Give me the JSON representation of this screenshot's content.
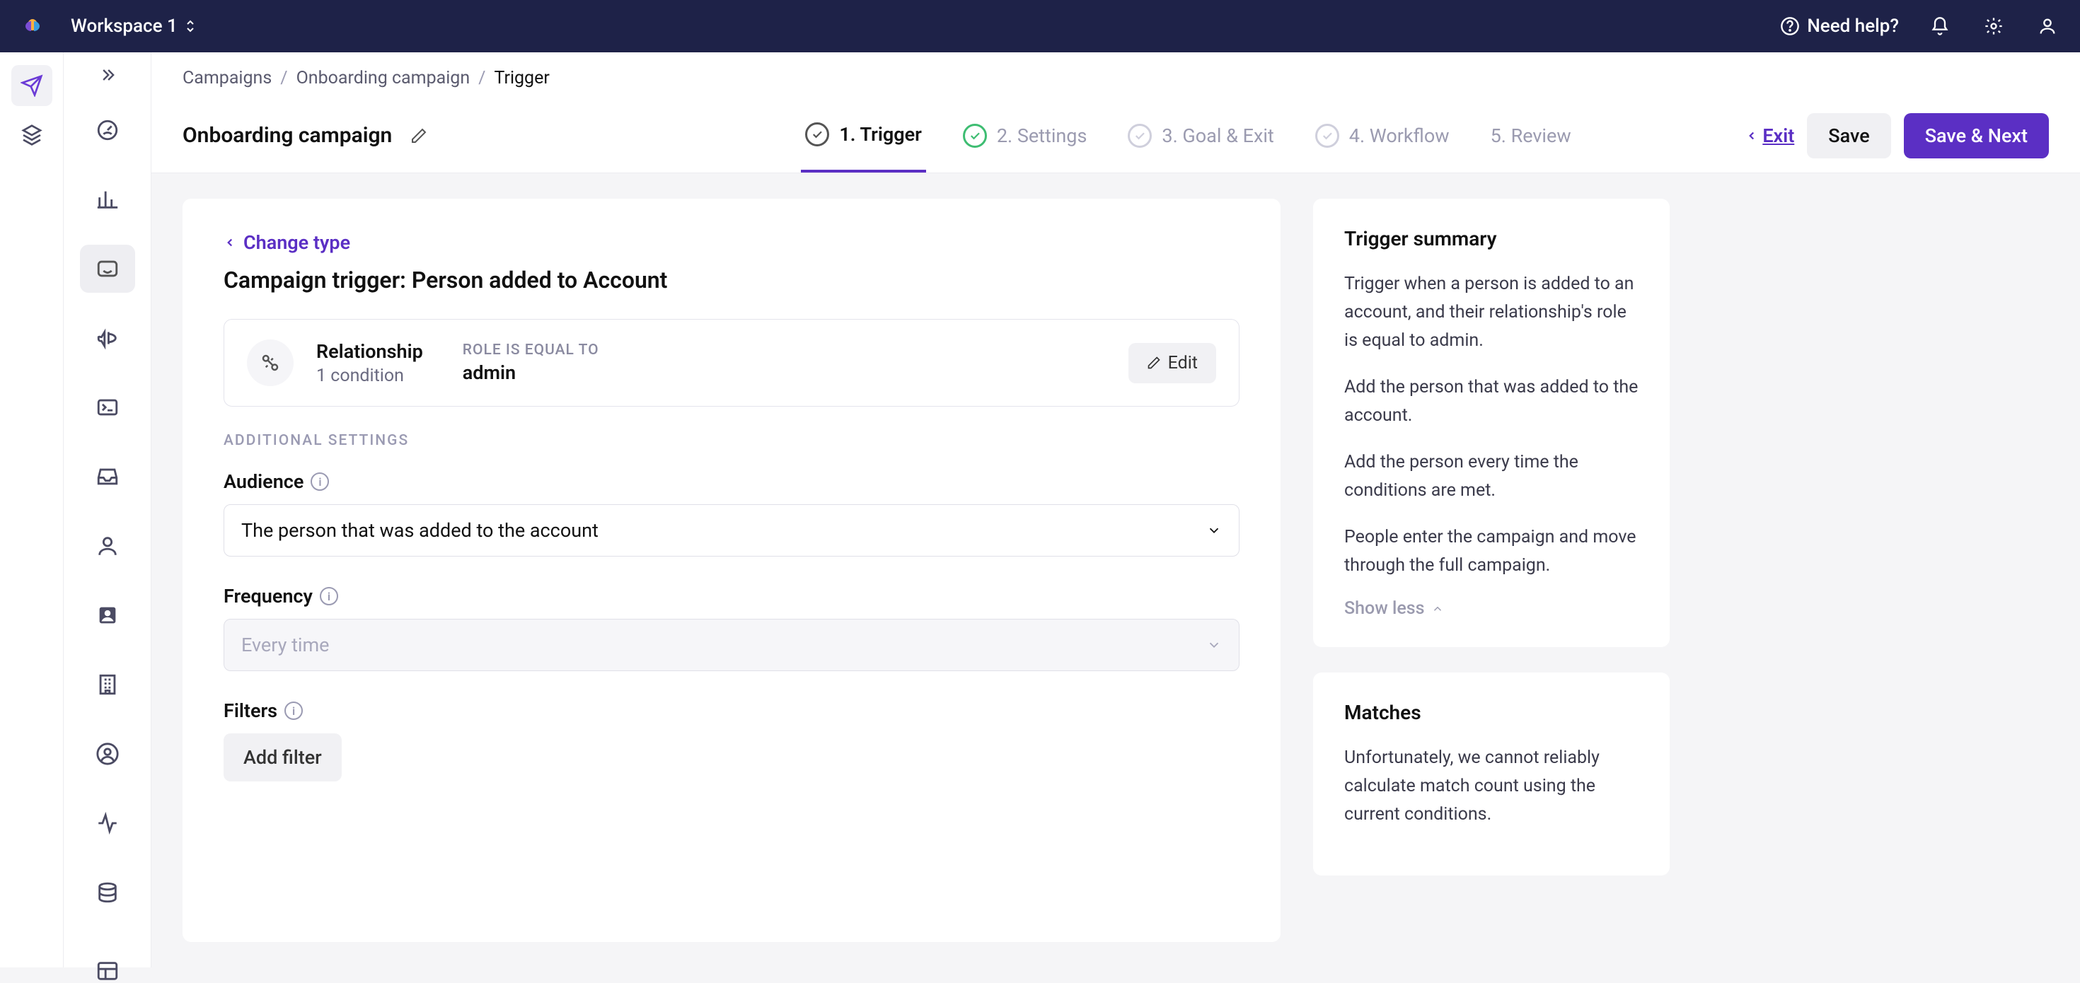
{
  "header": {
    "workspace_label": "Workspace 1",
    "need_help": "Need help?"
  },
  "breadcrumbs": {
    "items": [
      "Campaigns",
      "Onboarding campaign",
      "Trigger"
    ]
  },
  "page": {
    "title": "Onboarding campaign"
  },
  "steps": [
    {
      "label": "1. Trigger",
      "state": "active"
    },
    {
      "label": "2. Settings",
      "state": "done"
    },
    {
      "label": "3. Goal & Exit",
      "state": "pending"
    },
    {
      "label": "4. Workflow",
      "state": "pending"
    },
    {
      "label": "5. Review",
      "state": "none"
    }
  ],
  "actions": {
    "exit": "Exit",
    "save": "Save",
    "save_next": "Save & Next"
  },
  "trigger": {
    "change_type": "Change type",
    "heading": "Campaign trigger: Person added to Account",
    "condition": {
      "title": "Relationship",
      "sub": "1 condition",
      "rule_label": "ROLE IS EQUAL TO",
      "rule_value": "admin",
      "edit": "Edit"
    },
    "additional_settings": "ADDITIONAL SETTINGS",
    "audience": {
      "label": "Audience",
      "value": "The person that was added to the account"
    },
    "frequency": {
      "label": "Frequency",
      "value": "Every time"
    },
    "filters": {
      "label": "Filters",
      "add": "Add filter"
    }
  },
  "summary": {
    "title": "Trigger summary",
    "p1": "Trigger when a person is added to an account, and their relationship's role is equal to admin.",
    "p2": "Add the person that was added to the account.",
    "p3": "Add the person every time the conditions are met.",
    "p4": "People enter the campaign and move through the full campaign.",
    "show_less": "Show less"
  },
  "matches": {
    "title": "Matches",
    "body": "Unfortunately, we cannot reliably calculate match count using the current conditions."
  }
}
